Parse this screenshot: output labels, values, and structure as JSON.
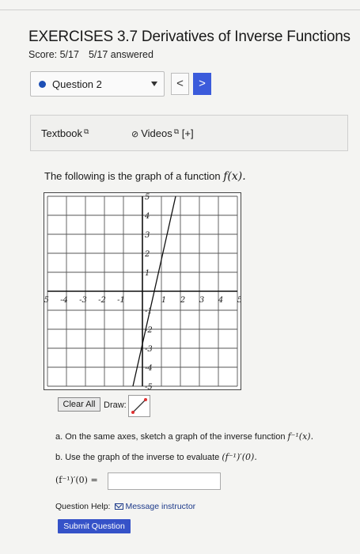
{
  "header": {
    "title": "EXERCISES 3.7 Derivatives of Inverse Functions",
    "score": "Score: 5/17",
    "answered": "5/17 answered"
  },
  "question_nav": {
    "label": "Question 2",
    "prev": "<",
    "next": ">"
  },
  "resources": {
    "textbook": "Textbook",
    "videos": "Videos",
    "videos_suffix": "[+]"
  },
  "prompt": {
    "text": "The following is the graph of a function",
    "fx": "f(x)."
  },
  "graph": {
    "x_ticks": [
      "-5",
      "-4",
      "-3",
      "-2",
      "-1",
      "1",
      "2",
      "3",
      "4",
      "5"
    ],
    "y_ticks": [
      "5",
      "4",
      "3",
      "2",
      "1",
      "-1",
      "-2",
      "-3",
      "-4",
      "-5"
    ],
    "x_range": [
      -5,
      5
    ],
    "y_range": [
      -5,
      5
    ],
    "line_through": [
      [
        -0.5,
        -5
      ],
      [
        1.75,
        5
      ]
    ],
    "grid": true
  },
  "draw": {
    "clear_label": "Clear All",
    "draw_label": "Draw:"
  },
  "questions": {
    "a": "a. On the same axes, sketch a graph of the inverse function",
    "a_fn": "f⁻¹(x).",
    "b": "b. Use the graph of the inverse to evaluate",
    "b_fn": "(f⁻¹)′(0).",
    "answer_label": "(f⁻¹)′(0) =",
    "answer_value": ""
  },
  "help": {
    "label": "Question Help:",
    "link": "Message instructor"
  },
  "submit": {
    "label": "Submit Question"
  },
  "colors": {
    "accent": "#3552c8",
    "dot": "#1d4fb5"
  }
}
